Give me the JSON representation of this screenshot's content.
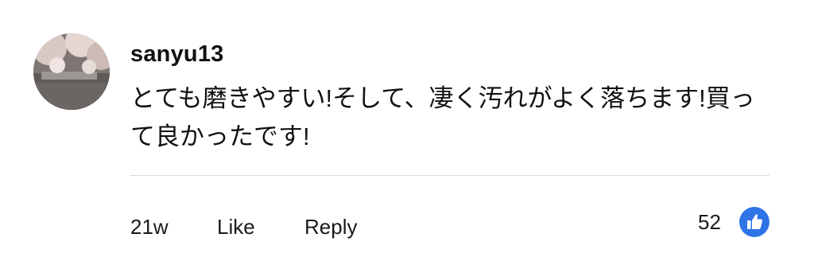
{
  "comment": {
    "username": "sanyu13",
    "text": "とても磨きやすい!そして、凄く汚れがよく落ちます!買って良かったです!",
    "time": "21w",
    "like_label": "Like",
    "reply_label": "Reply",
    "like_count": "52"
  },
  "icons": {
    "avatar": "user-avatar-photo",
    "like": "thumbs-up-icon"
  },
  "colors": {
    "like_icon_bg": "#2e74e6",
    "divider": "#d9d9d9"
  }
}
